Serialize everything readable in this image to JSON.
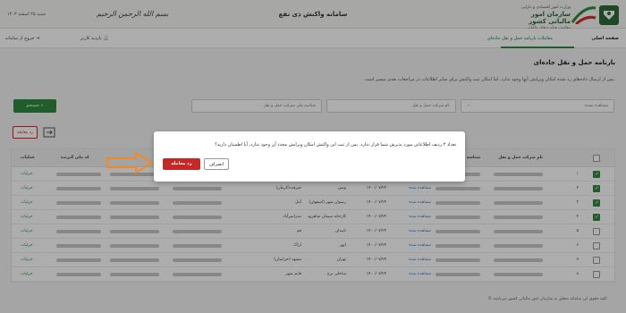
{
  "header": {
    "ministry": "وزارت امور اقتصادی و دارایی",
    "org_name": "سازمان امور مالیاتی کشور",
    "org_sub": "معاونت فناوری‌های مالیاتی",
    "system_title": "سامانه واکنش ذی نفع",
    "calligraphy": "بسم الله الرحمن الرحیم",
    "date": "شنبه ۲۵ اسفند ۱۴۰۳"
  },
  "nav": {
    "home": "صفحه اصلی",
    "transport": "معاملات بارنامه حمل و نقل جاده‌ای",
    "exit": "خروج از سامانه",
    "profile": "بازدید کاربر"
  },
  "page": {
    "title": "بارنامه حمل و نقل جاده‌ای",
    "subtitle": "پس از ارسال داده‌های رد شده امکان ویرایش آنها وجود ندارد. اما امکان ثبت واکنش برای سایر اطلاعات در مراجعات بعدی میسر است.",
    "filter_status": "مشاهده نشده",
    "filter_company": "نام شرکت حمل و نقل",
    "filter_nid": "شناسه ملی شرکت حمل و نقل",
    "search_label": "جستجو",
    "reject_label": "رد معامله",
    "footer_note": "© کلیه حقوق این سامانه متعلق به سازمان امور مالیاتی کشور می‌باشد."
  },
  "table": {
    "headers": {
      "company": "نام شرکت حمل و نقل",
      "nid": "شناسه ملی شرکت حمل و نقل",
      "bill": "شماره بارنامه",
      "date": "تاریخ",
      "origin": "مبدا",
      "dest": "مقصد",
      "postcode": "کد ملی گیرنده",
      "actions": "عملیات"
    },
    "rows": [
      {
        "idx": "۱",
        "checked": true,
        "date": "۱۴۰۰/۰۷/۲۴",
        "origin": "",
        "dest": "",
        "link": "مشاهده شده",
        "details": "جزئیات"
      },
      {
        "idx": "۲",
        "checked": true,
        "date": "۱۴۰۰/۰۷/۲۴",
        "origin": "ویس",
        "dest": "جیرفت(کرمان)",
        "link": "مشاهده شده",
        "details": "جزئیات"
      },
      {
        "idx": "۳",
        "checked": true,
        "date": "۱۴۰۰/۰۷/۲۴",
        "origin": "رضوان شهر (اصفهان)",
        "dest": "آمل",
        "link": "مشاهده شده",
        "details": "جزئیات"
      },
      {
        "idx": "۴",
        "checked": true,
        "date": "۱۴۰۰/۰۷/۲۴",
        "origin": "کارخانه سیمان شاهرود",
        "dest": "بندرامیرآباد",
        "link": "مشاهده شده",
        "details": "جزئیات"
      },
      {
        "idx": "۵",
        "checked": false,
        "date": "۱۴۰۰/۰۷/۲۴",
        "origin": "نایبدان",
        "dest": "قم",
        "link": "مشاهده شده",
        "details": "جزئیات"
      },
      {
        "idx": "۶",
        "checked": false,
        "date": "۱۴۰۰/۰۷/۲۴",
        "origin": "ابهر",
        "dest": "اراک",
        "link": "مشاهده شده",
        "details": "جزئیات"
      },
      {
        "idx": "۷",
        "checked": false,
        "date": "۱۴۰۰/۰۷/۲۴",
        "origin": "تهران",
        "dest": "مشهد (خراسان)",
        "link": "مشاهده شده",
        "details": "جزئیات"
      },
      {
        "idx": "۸",
        "checked": false,
        "date": "۱۴۰۰/۰۷/۲۴",
        "origin": "ساحلی برج",
        "dest": "قایم شهر",
        "link": "مشاهده شده",
        "details": "جزئیات"
      }
    ]
  },
  "modal": {
    "message": "تعداد ۴ ردیف اطلاعاتی مورد پذیرش شما قرار ندارد. پس از ثبت این واکنش امکان ویرایش مجدد آن وجود ندارد، آیا اطمینان دارید؟",
    "confirm_label": "رد معامله",
    "cancel_label": "انصراف"
  },
  "colors": {
    "accent": "#2e8b3e",
    "danger": "#c62828",
    "arrow": "#f08a24"
  }
}
